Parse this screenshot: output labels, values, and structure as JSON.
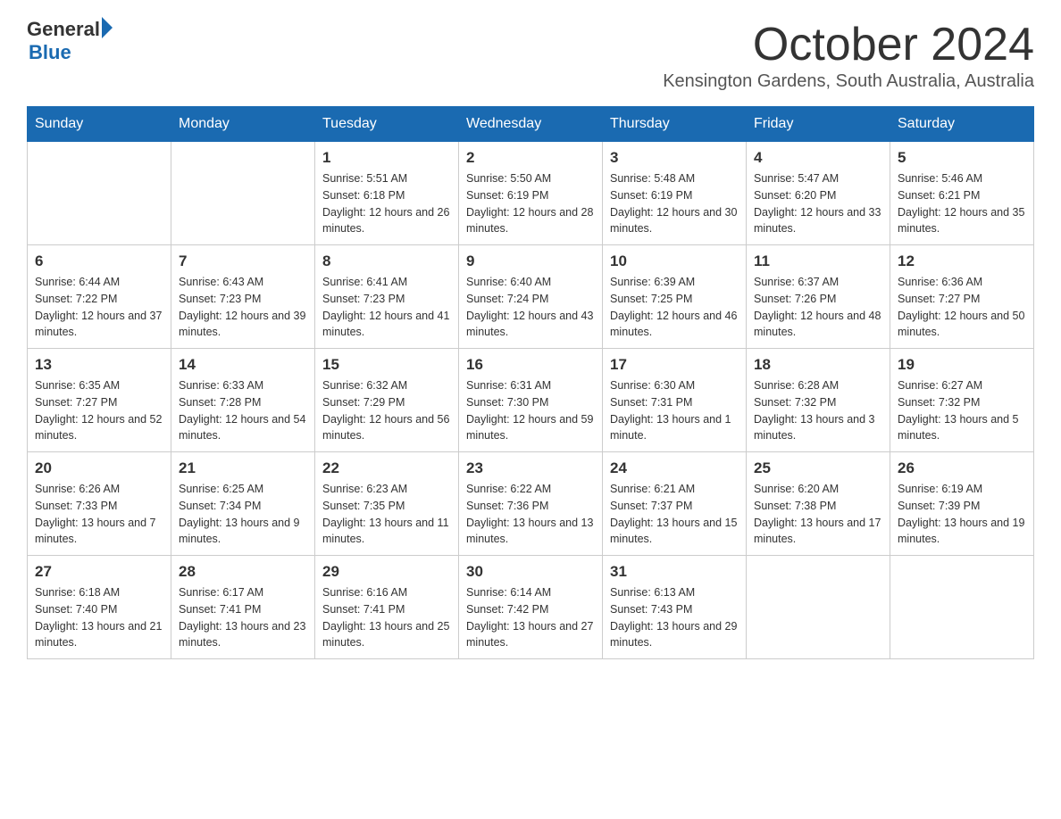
{
  "logo": {
    "text_general": "General",
    "triangle": "▶",
    "text_blue": "Blue"
  },
  "title": "October 2024",
  "location": "Kensington Gardens, South Australia, Australia",
  "days_of_week": [
    "Sunday",
    "Monday",
    "Tuesday",
    "Wednesday",
    "Thursday",
    "Friday",
    "Saturday"
  ],
  "weeks": [
    [
      {
        "day": "",
        "sunrise": "",
        "sunset": "",
        "daylight": ""
      },
      {
        "day": "",
        "sunrise": "",
        "sunset": "",
        "daylight": ""
      },
      {
        "day": "1",
        "sunrise": "Sunrise: 5:51 AM",
        "sunset": "Sunset: 6:18 PM",
        "daylight": "Daylight: 12 hours and 26 minutes."
      },
      {
        "day": "2",
        "sunrise": "Sunrise: 5:50 AM",
        "sunset": "Sunset: 6:19 PM",
        "daylight": "Daylight: 12 hours and 28 minutes."
      },
      {
        "day": "3",
        "sunrise": "Sunrise: 5:48 AM",
        "sunset": "Sunset: 6:19 PM",
        "daylight": "Daylight: 12 hours and 30 minutes."
      },
      {
        "day": "4",
        "sunrise": "Sunrise: 5:47 AM",
        "sunset": "Sunset: 6:20 PM",
        "daylight": "Daylight: 12 hours and 33 minutes."
      },
      {
        "day": "5",
        "sunrise": "Sunrise: 5:46 AM",
        "sunset": "Sunset: 6:21 PM",
        "daylight": "Daylight: 12 hours and 35 minutes."
      }
    ],
    [
      {
        "day": "6",
        "sunrise": "Sunrise: 6:44 AM",
        "sunset": "Sunset: 7:22 PM",
        "daylight": "Daylight: 12 hours and 37 minutes."
      },
      {
        "day": "7",
        "sunrise": "Sunrise: 6:43 AM",
        "sunset": "Sunset: 7:23 PM",
        "daylight": "Daylight: 12 hours and 39 minutes."
      },
      {
        "day": "8",
        "sunrise": "Sunrise: 6:41 AM",
        "sunset": "Sunset: 7:23 PM",
        "daylight": "Daylight: 12 hours and 41 minutes."
      },
      {
        "day": "9",
        "sunrise": "Sunrise: 6:40 AM",
        "sunset": "Sunset: 7:24 PM",
        "daylight": "Daylight: 12 hours and 43 minutes."
      },
      {
        "day": "10",
        "sunrise": "Sunrise: 6:39 AM",
        "sunset": "Sunset: 7:25 PM",
        "daylight": "Daylight: 12 hours and 46 minutes."
      },
      {
        "day": "11",
        "sunrise": "Sunrise: 6:37 AM",
        "sunset": "Sunset: 7:26 PM",
        "daylight": "Daylight: 12 hours and 48 minutes."
      },
      {
        "day": "12",
        "sunrise": "Sunrise: 6:36 AM",
        "sunset": "Sunset: 7:27 PM",
        "daylight": "Daylight: 12 hours and 50 minutes."
      }
    ],
    [
      {
        "day": "13",
        "sunrise": "Sunrise: 6:35 AM",
        "sunset": "Sunset: 7:27 PM",
        "daylight": "Daylight: 12 hours and 52 minutes."
      },
      {
        "day": "14",
        "sunrise": "Sunrise: 6:33 AM",
        "sunset": "Sunset: 7:28 PM",
        "daylight": "Daylight: 12 hours and 54 minutes."
      },
      {
        "day": "15",
        "sunrise": "Sunrise: 6:32 AM",
        "sunset": "Sunset: 7:29 PM",
        "daylight": "Daylight: 12 hours and 56 minutes."
      },
      {
        "day": "16",
        "sunrise": "Sunrise: 6:31 AM",
        "sunset": "Sunset: 7:30 PM",
        "daylight": "Daylight: 12 hours and 59 minutes."
      },
      {
        "day": "17",
        "sunrise": "Sunrise: 6:30 AM",
        "sunset": "Sunset: 7:31 PM",
        "daylight": "Daylight: 13 hours and 1 minute."
      },
      {
        "day": "18",
        "sunrise": "Sunrise: 6:28 AM",
        "sunset": "Sunset: 7:32 PM",
        "daylight": "Daylight: 13 hours and 3 minutes."
      },
      {
        "day": "19",
        "sunrise": "Sunrise: 6:27 AM",
        "sunset": "Sunset: 7:32 PM",
        "daylight": "Daylight: 13 hours and 5 minutes."
      }
    ],
    [
      {
        "day": "20",
        "sunrise": "Sunrise: 6:26 AM",
        "sunset": "Sunset: 7:33 PM",
        "daylight": "Daylight: 13 hours and 7 minutes."
      },
      {
        "day": "21",
        "sunrise": "Sunrise: 6:25 AM",
        "sunset": "Sunset: 7:34 PM",
        "daylight": "Daylight: 13 hours and 9 minutes."
      },
      {
        "day": "22",
        "sunrise": "Sunrise: 6:23 AM",
        "sunset": "Sunset: 7:35 PM",
        "daylight": "Daylight: 13 hours and 11 minutes."
      },
      {
        "day": "23",
        "sunrise": "Sunrise: 6:22 AM",
        "sunset": "Sunset: 7:36 PM",
        "daylight": "Daylight: 13 hours and 13 minutes."
      },
      {
        "day": "24",
        "sunrise": "Sunrise: 6:21 AM",
        "sunset": "Sunset: 7:37 PM",
        "daylight": "Daylight: 13 hours and 15 minutes."
      },
      {
        "day": "25",
        "sunrise": "Sunrise: 6:20 AM",
        "sunset": "Sunset: 7:38 PM",
        "daylight": "Daylight: 13 hours and 17 minutes."
      },
      {
        "day": "26",
        "sunrise": "Sunrise: 6:19 AM",
        "sunset": "Sunset: 7:39 PM",
        "daylight": "Daylight: 13 hours and 19 minutes."
      }
    ],
    [
      {
        "day": "27",
        "sunrise": "Sunrise: 6:18 AM",
        "sunset": "Sunset: 7:40 PM",
        "daylight": "Daylight: 13 hours and 21 minutes."
      },
      {
        "day": "28",
        "sunrise": "Sunrise: 6:17 AM",
        "sunset": "Sunset: 7:41 PM",
        "daylight": "Daylight: 13 hours and 23 minutes."
      },
      {
        "day": "29",
        "sunrise": "Sunrise: 6:16 AM",
        "sunset": "Sunset: 7:41 PM",
        "daylight": "Daylight: 13 hours and 25 minutes."
      },
      {
        "day": "30",
        "sunrise": "Sunrise: 6:14 AM",
        "sunset": "Sunset: 7:42 PM",
        "daylight": "Daylight: 13 hours and 27 minutes."
      },
      {
        "day": "31",
        "sunrise": "Sunrise: 6:13 AM",
        "sunset": "Sunset: 7:43 PM",
        "daylight": "Daylight: 13 hours and 29 minutes."
      },
      {
        "day": "",
        "sunrise": "",
        "sunset": "",
        "daylight": ""
      },
      {
        "day": "",
        "sunrise": "",
        "sunset": "",
        "daylight": ""
      }
    ]
  ]
}
